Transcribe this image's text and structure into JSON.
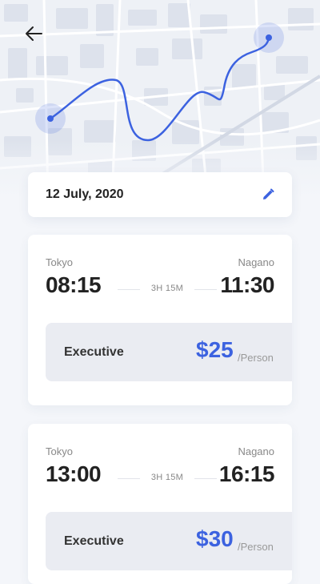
{
  "header": {
    "back_icon": "arrow-left-icon"
  },
  "map": {
    "route_color": "#3c62e0",
    "origin_marker": "origin-pin-icon",
    "destination_marker": "destination-pin-icon"
  },
  "date_card": {
    "date": "12 July, 2020",
    "edit_icon": "pencil-icon"
  },
  "trips": [
    {
      "origin": "Tokyo",
      "destination": "Nagano",
      "departure": "08:15",
      "arrival": "11:30",
      "duration": "3H 15M",
      "fare_class": "Executive",
      "price": "$25",
      "unit": "/Person"
    },
    {
      "origin": "Tokyo",
      "destination": "Nagano",
      "departure": "13:00",
      "arrival": "16:15",
      "duration": "3H 15M",
      "fare_class": "Executive",
      "price": "$30",
      "unit": "/Person"
    }
  ],
  "colors": {
    "accent": "#3c62e0",
    "card": "#ffffff",
    "fare_bg": "#eaecf2",
    "background": "#f4f6fa"
  }
}
